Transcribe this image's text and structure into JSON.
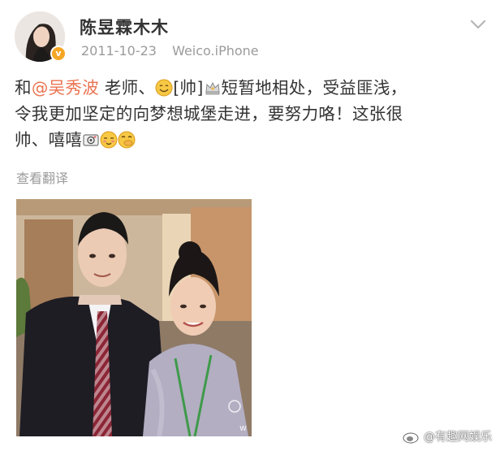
{
  "post": {
    "username": "陈昱霖木木",
    "date": "2011-10-23",
    "source": "Weico.iPhone",
    "verified_badge": "v",
    "content": {
      "prefix": "和",
      "mention": "@吴秀波",
      "after_mention": " 老师、",
      "emoji_1": "smile-emoji",
      "tag": "[帅]",
      "emoji_2": "crown-emoji",
      "text_1": "短暂地相处，受益匪浅，",
      "line_2": "令我更加坚定的向梦想城堡走进，要努力咯！这张很",
      "line_3": "帅、嘻嘻",
      "emoji_3": "camera-emoji",
      "emoji_4": "blush-emoji",
      "emoji_5": "giggle-emoji"
    },
    "translate_label": "查看翻译",
    "photo_watermark": "w"
  },
  "watermark": {
    "text": "@有趣网娱乐"
  },
  "colors": {
    "mention": "#eb7350",
    "meta": "#9b9b9b",
    "text": "#333333"
  }
}
